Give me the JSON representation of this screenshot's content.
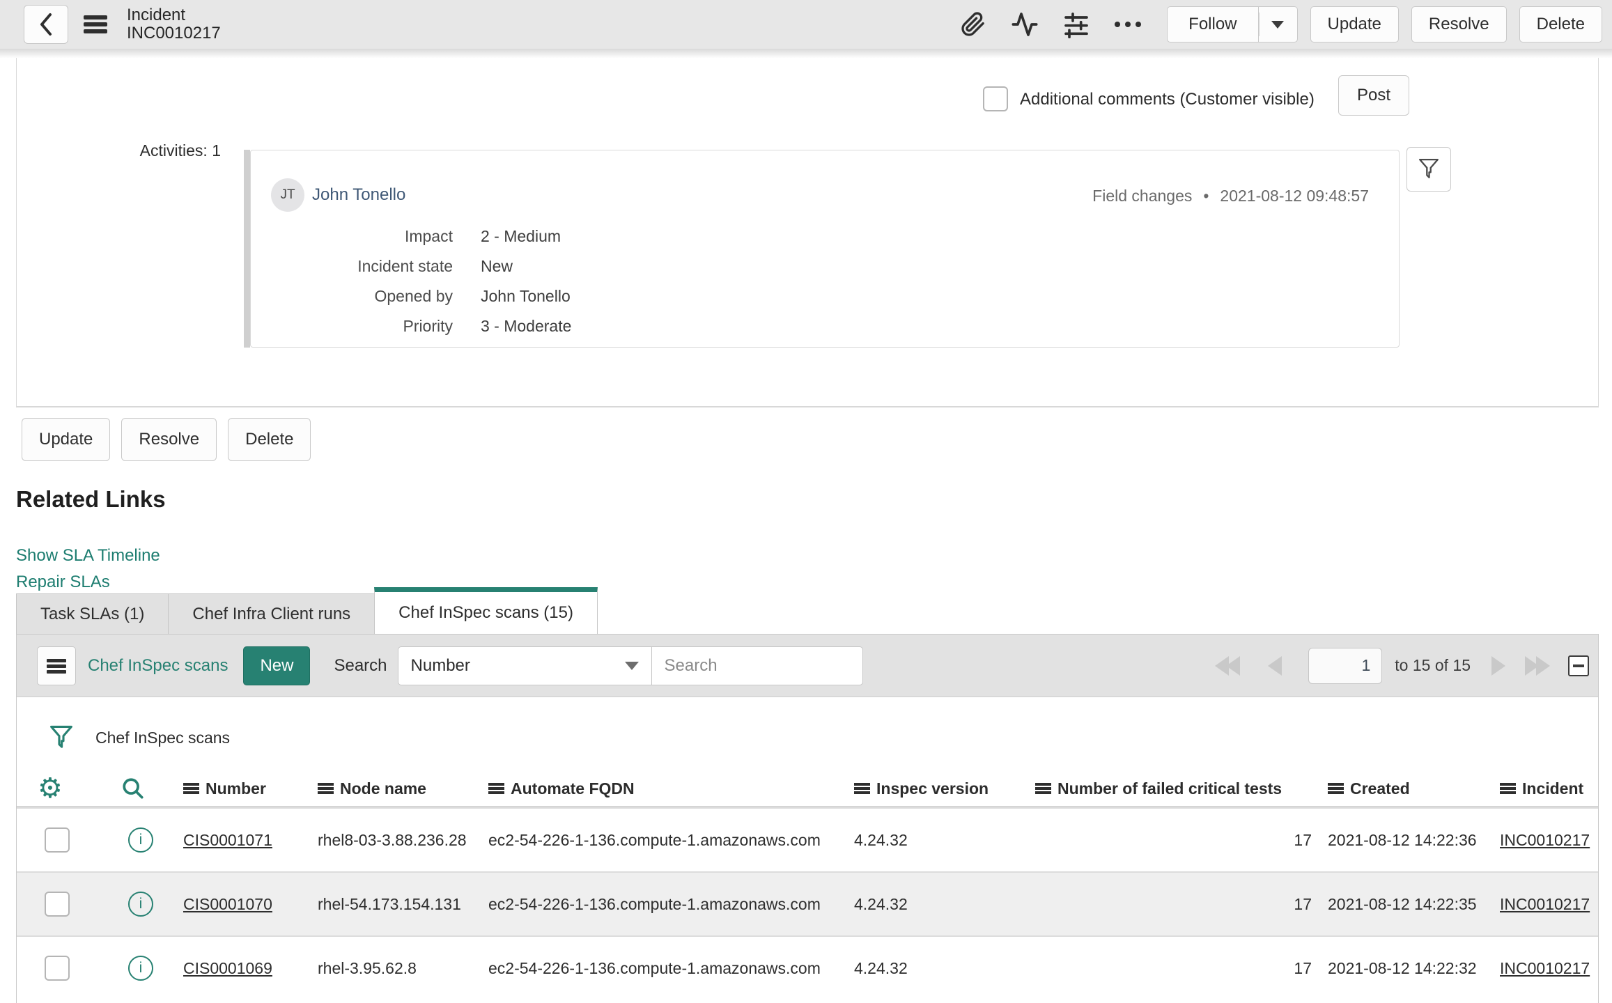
{
  "header": {
    "title_line1": "Incident",
    "title_line2": "INC0010217",
    "follow_label": "Follow",
    "update_label": "Update",
    "resolve_label": "Resolve",
    "delete_label": "Delete"
  },
  "comment_bar": {
    "label": "Additional comments (Customer visible)",
    "post_label": "Post"
  },
  "activity": {
    "count_label": "Activities: 1",
    "avatar_initials": "JT",
    "user": "John Tonello",
    "event_type": "Field changes",
    "bullet": "•",
    "timestamp": "2021-08-12 09:48:57",
    "fields": [
      {
        "label": "Impact",
        "value": "2 - Medium"
      },
      {
        "label": "Incident state",
        "value": "New"
      },
      {
        "label": "Opened by",
        "value": "John Tonello"
      },
      {
        "label": "Priority",
        "value": "3 - Moderate"
      }
    ]
  },
  "form_actions": {
    "update_label": "Update",
    "resolve_label": "Resolve",
    "delete_label": "Delete"
  },
  "related_links": {
    "title": "Related Links",
    "link1": "Show SLA Timeline",
    "link2": "Repair SLAs"
  },
  "tabs": [
    {
      "label": "Task SLAs (1)"
    },
    {
      "label": "Chef Infra Client runs"
    },
    {
      "label": "Chef InSpec scans (15)"
    }
  ],
  "list": {
    "title": "Chef InSpec scans",
    "new_label": "New",
    "search_label": "Search",
    "search_column": "Number",
    "search_placeholder": "Search",
    "page_value": "1",
    "range_label": "to 15 of 15",
    "breadcrumb": "Chef InSpec scans",
    "columns": {
      "number": "Number",
      "node_name": "Node name",
      "automate_fqdn": "Automate FQDN",
      "inspec_version": "Inspec version",
      "failed_tests": "Number of failed critical tests",
      "created": "Created",
      "incident": "Incident"
    },
    "rows": [
      {
        "number": "CIS0001071",
        "node_name": "rhel8-03-3.88.236.28",
        "automate_fqdn": "ec2-54-226-1-136.compute-1.amazonaws.com",
        "inspec_version": "4.24.32",
        "failed_tests": "17",
        "created": "2021-08-12 14:22:36",
        "incident": "INC0010217"
      },
      {
        "number": "CIS0001070",
        "node_name": "rhel-54.173.154.131",
        "automate_fqdn": "ec2-54-226-1-136.compute-1.amazonaws.com",
        "inspec_version": "4.24.32",
        "failed_tests": "17",
        "created": "2021-08-12 14:22:35",
        "incident": "INC0010217"
      },
      {
        "number": "CIS0001069",
        "node_name": "rhel-3.95.62.8",
        "automate_fqdn": "ec2-54-226-1-136.compute-1.amazonaws.com",
        "inspec_version": "4.24.32",
        "failed_tests": "17",
        "created": "2021-08-12 14:22:32",
        "incident": "INC0010217"
      }
    ]
  },
  "glyphs": {
    "info": "i",
    "gear": "⚙"
  },
  "colors": {
    "accent_teal": "#278172",
    "header_bg": "#e7e7e7",
    "toolbar_bg": "#e2e2e2",
    "alt_row_bg": "#efefef"
  }
}
